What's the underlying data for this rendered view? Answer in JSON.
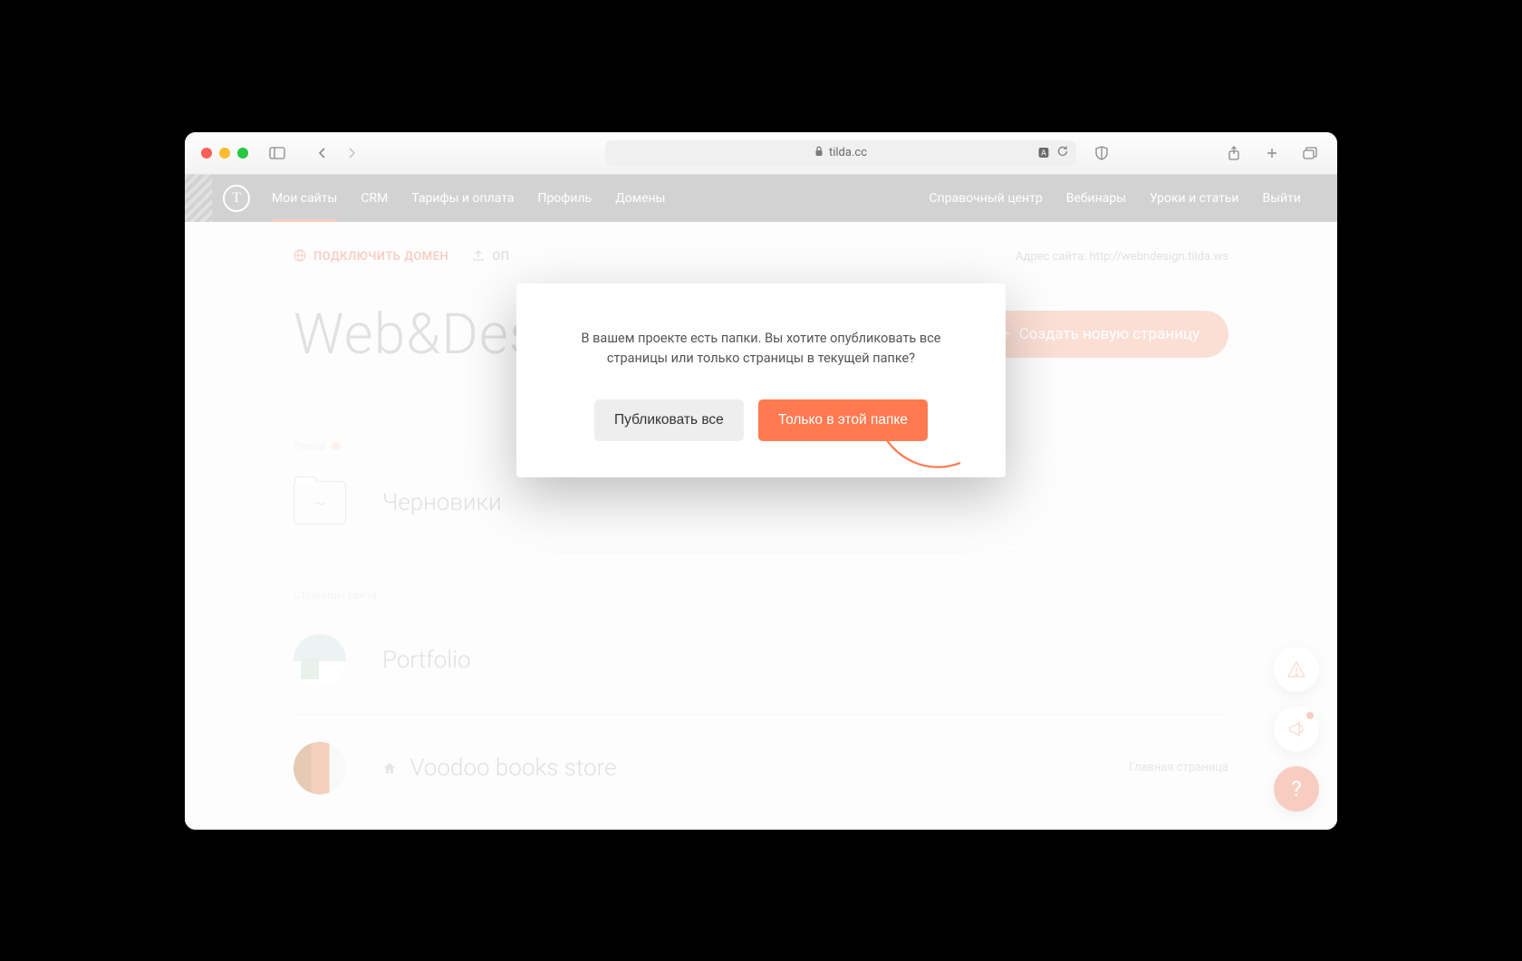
{
  "browser": {
    "url_host": "tilda.cc"
  },
  "nav": {
    "items": [
      {
        "label": "Мои сайты",
        "active": true
      },
      {
        "label": "CRM"
      },
      {
        "label": "Тарифы и оплата"
      },
      {
        "label": "Профиль"
      },
      {
        "label": "Домены"
      }
    ],
    "right": [
      {
        "label": "Справочный центр"
      },
      {
        "label": "Вебинары"
      },
      {
        "label": "Уроки и статьи"
      },
      {
        "label": "Выйти"
      }
    ]
  },
  "topline": {
    "connect_domain": "ПОДКЛЮЧИТЬ ДОМЕН",
    "publish_all": "ОП",
    "site_address_label": "Адрес сайта:",
    "site_address_url": "http://webndesign.tilda.ws"
  },
  "site": {
    "title": "Web&Design",
    "create_page": "Создать новую страницу"
  },
  "sections": {
    "folders_label": "Папки",
    "pages_label": "Страницы сайта"
  },
  "folders": [
    {
      "name": "Черновики",
      "symbol": "~"
    }
  ],
  "pages": [
    {
      "name": "Portfolio",
      "is_home": false,
      "meta": ""
    },
    {
      "name": "Voodoo books store",
      "is_home": true,
      "meta": "Главная страница"
    }
  ],
  "modal": {
    "message": "В вашем проекте есть папки. Вы хотите опубликовать все страницы или только страницы в текущей папке?",
    "publish_all": "Публиковать все",
    "only_folder": "Только в этой папке"
  },
  "fab": {
    "help": "?"
  }
}
